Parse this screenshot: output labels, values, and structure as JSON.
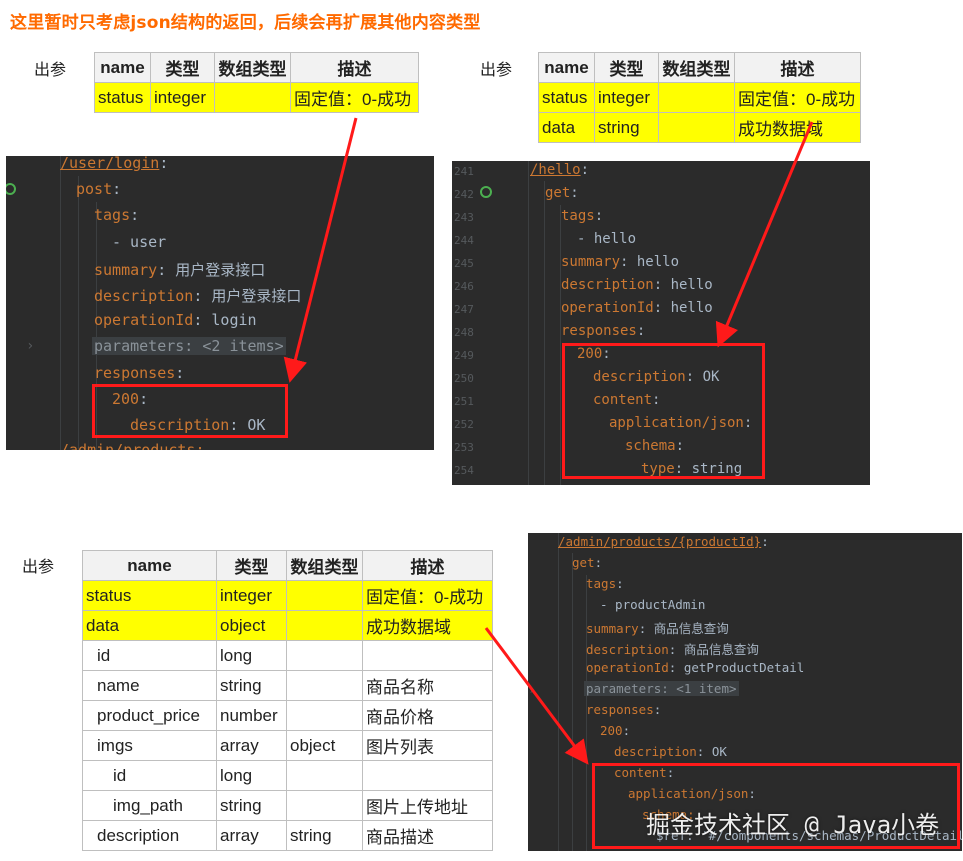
{
  "headline": "这里暂时只考虑json结构的返回，后续会再扩展其他内容类型",
  "param_label": "出参",
  "table_headers": [
    "name",
    "类型",
    "数组类型",
    "描述"
  ],
  "table1": {
    "rows": [
      {
        "name": "status",
        "type": "integer",
        "array_type": "",
        "desc": "固定值：0-成功"
      }
    ]
  },
  "table2": {
    "rows": [
      {
        "name": "status",
        "type": "integer",
        "array_type": "",
        "desc": "固定值：0-成功"
      },
      {
        "name": "data",
        "type": "string",
        "array_type": "",
        "desc": "成功数据域"
      }
    ]
  },
  "table3": {
    "rows": [
      {
        "name": "status",
        "type": "integer",
        "array_type": "",
        "desc": "固定值：0-成功"
      },
      {
        "name": "data",
        "type": "object",
        "array_type": "",
        "desc": "成功数据域"
      },
      {
        "name": "id",
        "type": "long",
        "array_type": "",
        "desc": ""
      },
      {
        "name": "name",
        "type": "string",
        "array_type": "",
        "desc": "商品名称"
      },
      {
        "name": "product_price",
        "type": "number",
        "array_type": "",
        "desc": "商品价格"
      },
      {
        "name": "imgs",
        "type": "array",
        "array_type": "object",
        "desc": "图片列表"
      },
      {
        "name": "id",
        "type": "long",
        "array_type": "",
        "desc": ""
      },
      {
        "name": "img_path",
        "type": "string",
        "array_type": "",
        "desc": "图片上传地址"
      },
      {
        "name": "description",
        "type": "array",
        "array_type": "string",
        "desc": "商品描述"
      }
    ]
  },
  "code1": {
    "path": "/user/login",
    "post": "post",
    "tags": "tags",
    "tag_item": "- user",
    "summary_key": "summary",
    "summary_val": "用户登录接口",
    "description_key": "description",
    "description_val": "用户登录接口",
    "operationId_key": "operationId",
    "operationId_val": "login",
    "parameters_fold": "parameters: <2 items>",
    "responses": "responses",
    "code_200": "200",
    "resp_desc_key": "description",
    "resp_desc_val": "OK",
    "next_path": "/admin/products:"
  },
  "code2": {
    "line_numbers": [
      "241",
      "242",
      "243",
      "244",
      "245",
      "246",
      "247",
      "248",
      "249",
      "250",
      "251",
      "252",
      "253",
      "254"
    ],
    "path": "/hello",
    "get": "get",
    "tags": "tags",
    "tag_item": "- hello",
    "summary_key": "summary",
    "summary_val": "hello",
    "description_key": "description",
    "description_val": "hello",
    "operationId_key": "operationId",
    "operationId_val": "hello",
    "responses": "responses",
    "code_200": "200",
    "resp_desc_key": "description",
    "resp_desc_val": "OK",
    "content": "content",
    "media": "application/json",
    "schema": "schema",
    "type_key": "type",
    "type_val": "string"
  },
  "code3": {
    "path": "/admin/products/{productId}",
    "get": "get",
    "tags": "tags",
    "tag_item": "- productAdmin",
    "summary_key": "summary",
    "summary_val": "商品信息查询",
    "description_key": "description",
    "description_val": "商品信息查询",
    "operationId_key": "operationId",
    "operationId_val": "getProductDetail",
    "parameters_fold": "parameters: <1 item>",
    "responses": "responses",
    "code_200": "200",
    "resp_desc_key": "description",
    "resp_desc_val": "OK",
    "content": "content",
    "media": "application/json",
    "schema_partial": "schema:",
    "ref_partial": "$ref: '#/components/schemas/ProductDetail'"
  },
  "watermark": "掘金技术社区 @ Java小卷",
  "colors": {
    "headline": "#ff6a00",
    "highlight": "#ffff00",
    "arrow": "#ff1a1a",
    "editor_bg": "#2b2b2b",
    "key": "#cc7832",
    "value": "#a9b7c6"
  }
}
